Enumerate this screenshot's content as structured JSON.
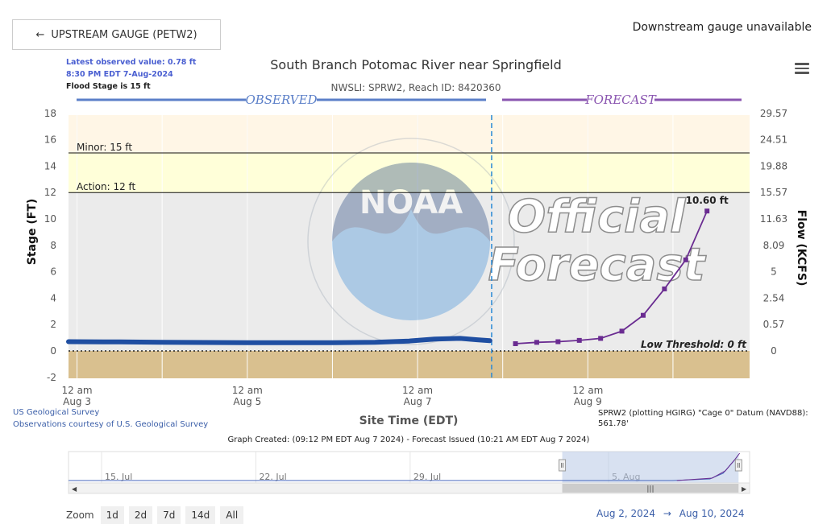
{
  "nav": {
    "upstream_label": "UPSTREAM GAUGE (PETW2)",
    "downstream_text": "Downstream gauge unavailable"
  },
  "info": {
    "latest_observed": "Latest observed value: 0.78 ft",
    "latest_time": "8:30 PM EDT 7-Aug-2024",
    "flood_stage": "Flood Stage is 15 ft"
  },
  "chart_data": {
    "type": "line",
    "title": "South Branch Potomac River near Springfield",
    "subtitle": "NWSLI: SPRW2, Reach ID: 8420360",
    "xlabel": "Site Time (EDT)",
    "ylabel": "Stage (FT)",
    "y2label": "Flow (KCFS)",
    "ylim": [
      -2.5,
      18
    ],
    "y_ticks": [
      -2,
      0,
      2,
      4,
      6,
      8,
      10,
      12,
      14,
      16,
      18
    ],
    "y2_ticks": [
      {
        "stage": 0,
        "label": "0"
      },
      {
        "stage": 2,
        "label": "0.57"
      },
      {
        "stage": 4,
        "label": "2.54"
      },
      {
        "stage": 6,
        "label": "5"
      },
      {
        "stage": 8,
        "label": "8.09"
      },
      {
        "stage": 10,
        "label": "11.63"
      },
      {
        "stage": 12,
        "label": "15.57"
      },
      {
        "stage": 14,
        "label": "19.88"
      },
      {
        "stage": 16,
        "label": "24.51"
      },
      {
        "stage": 18,
        "label": "29.57"
      }
    ],
    "x_range_days": [
      2.9,
      10.9
    ],
    "x_ticks": [
      {
        "day": 3,
        "label1": "12 am",
        "label2": "Aug 3"
      },
      {
        "day": 5,
        "label1": "12 am",
        "label2": "Aug 5"
      },
      {
        "day": 7,
        "label1": "12 am",
        "label2": "Aug 7"
      },
      {
        "day": 9,
        "label1": "12 am",
        "label2": "Aug 9"
      }
    ],
    "section_labels": {
      "observed": "OBSERVED",
      "forecast": "FORECAST"
    },
    "thresholds": [
      {
        "name": "Minor",
        "label": "Minor: 15 ft",
        "value": 15,
        "color": "#ffffd9"
      },
      {
        "name": "Action",
        "label": "Action: 12 ft",
        "value": 12,
        "color": "#ffffe3"
      },
      {
        "name": "Low Threshold",
        "label": "Low Threshold: 0 ft",
        "value": 0
      }
    ],
    "observed": {
      "color": "#1f4ea1",
      "x": [
        2.9,
        3.5,
        4.0,
        4.5,
        5.0,
        5.5,
        6.0,
        6.5,
        6.9,
        7.2,
        7.5,
        7.7,
        7.85
      ],
      "y": [
        0.7,
        0.68,
        0.66,
        0.64,
        0.63,
        0.62,
        0.62,
        0.65,
        0.75,
        0.9,
        0.95,
        0.85,
        0.78
      ]
    },
    "forecast": {
      "color": "#6a2c91",
      "x": [
        8.15,
        8.4,
        8.65,
        8.9,
        9.15,
        9.4,
        9.65,
        9.9,
        10.15,
        10.4
      ],
      "y": [
        0.55,
        0.65,
        0.7,
        0.8,
        0.95,
        1.5,
        2.7,
        4.7,
        6.9,
        10.6
      ],
      "peak_label": "10.60 ft"
    },
    "now_day": 7.87,
    "watermark_text": "Official Forecast",
    "source_lines": [
      "US Geological Survey",
      "Observations courtesy of U.S. Geological Survey"
    ],
    "datum_note": "SPRW2 (plotting HGIRG) \"Cage 0\" Datum (NAVD88): 561.78'",
    "created_note": "Graph Created: (09:12 PM EDT Aug 7 2024) - Forecast Issued (10:21 AM EDT Aug 7 2024)",
    "navigator": {
      "labels": [
        {
          "day": -18,
          "text": "15. Jul"
        },
        {
          "day": -11,
          "text": "22. Jul"
        },
        {
          "day": -4,
          "text": "29. Jul"
        },
        {
          "day": 5,
          "text": "5. Aug"
        }
      ],
      "range_days": [
        -19.5,
        11.4
      ]
    },
    "zoom": {
      "label": "Zoom",
      "buttons": [
        "1d",
        "2d",
        "7d",
        "14d",
        "All"
      ]
    },
    "date_range": {
      "from": "Aug 2, 2024",
      "arrow": "→",
      "to": "Aug 10, 2024"
    }
  }
}
